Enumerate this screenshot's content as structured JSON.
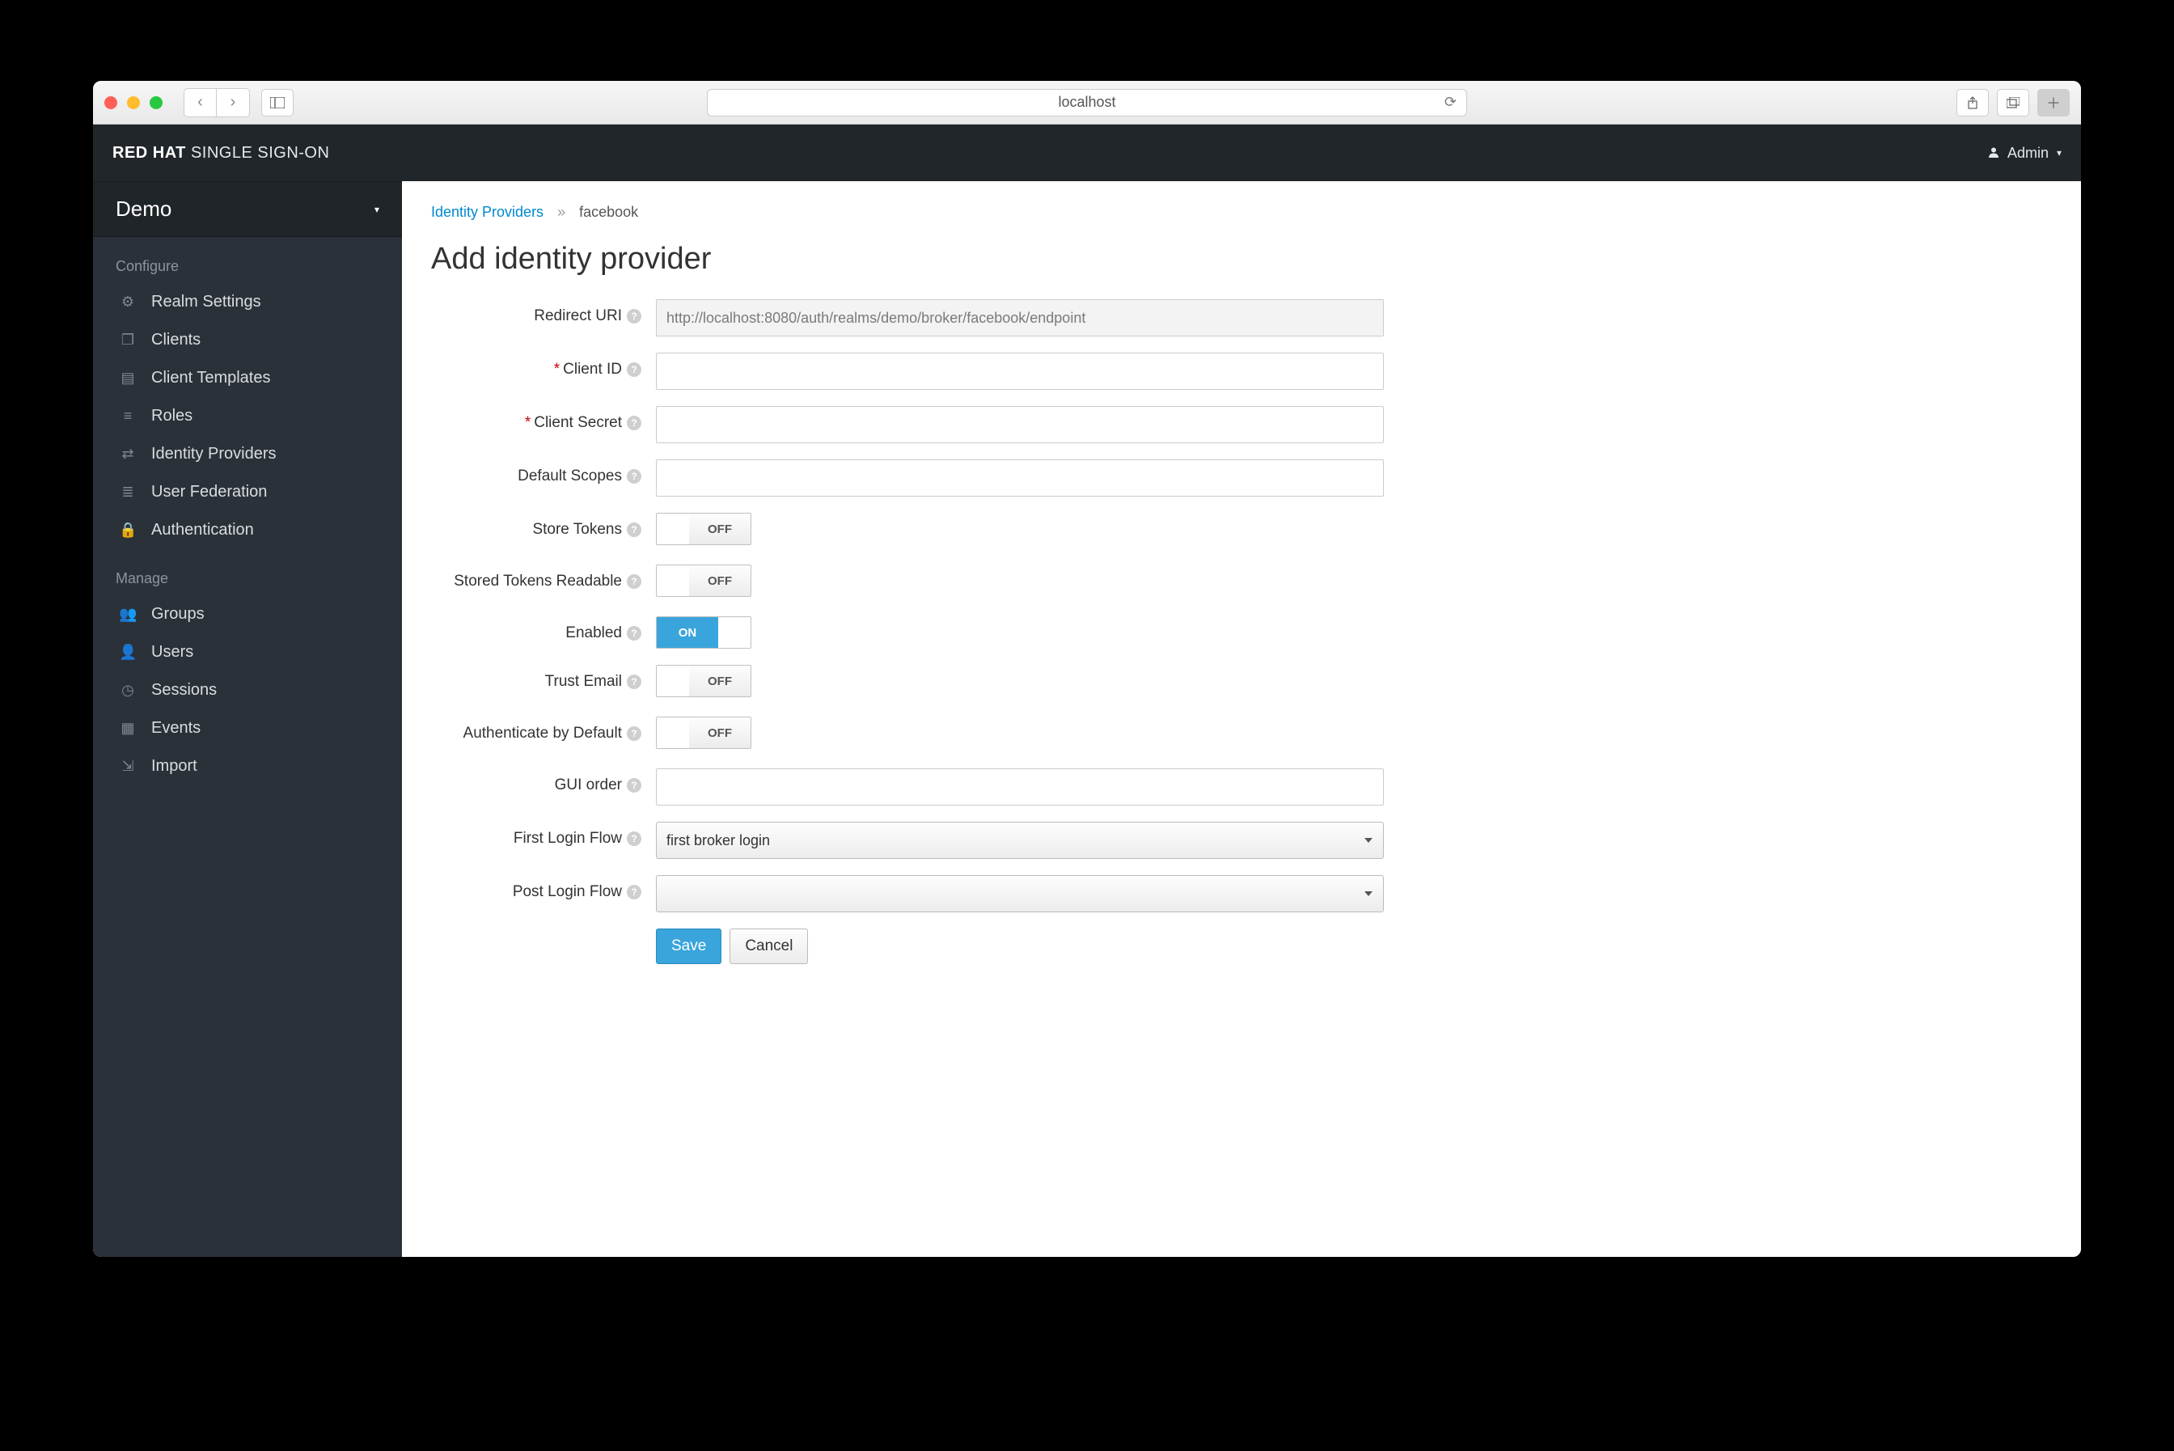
{
  "browser": {
    "url": "localhost"
  },
  "brand": {
    "bold": "RED HAT",
    "light": " SINGLE SIGN-ON"
  },
  "user": {
    "name": "Admin"
  },
  "realm": "Demo",
  "sidebar": {
    "sections": [
      {
        "label": "Configure",
        "items": [
          {
            "icon": "sliders",
            "label": "Realm Settings"
          },
          {
            "icon": "cube",
            "label": "Clients"
          },
          {
            "icon": "cubes",
            "label": "Client Templates"
          },
          {
            "icon": "list",
            "label": "Roles"
          },
          {
            "icon": "exchange",
            "label": "Identity Providers"
          },
          {
            "icon": "database",
            "label": "User Federation"
          },
          {
            "icon": "lock",
            "label": "Authentication"
          }
        ]
      },
      {
        "label": "Manage",
        "items": [
          {
            "icon": "users",
            "label": "Groups"
          },
          {
            "icon": "user",
            "label": "Users"
          },
          {
            "icon": "clock",
            "label": "Sessions"
          },
          {
            "icon": "calendar",
            "label": "Events"
          },
          {
            "icon": "import",
            "label": "Import"
          }
        ]
      }
    ]
  },
  "breadcrumb": {
    "link": "Identity Providers",
    "current": "facebook"
  },
  "page_title": "Add identity provider",
  "fields": {
    "redirect_uri": {
      "label": "Redirect URI",
      "value": "http://localhost:8080/auth/realms/demo/broker/facebook/endpoint"
    },
    "client_id": {
      "label": "Client ID",
      "required": true,
      "value": ""
    },
    "client_secret": {
      "label": "Client Secret",
      "required": true,
      "value": ""
    },
    "default_scopes": {
      "label": "Default Scopes",
      "value": ""
    },
    "store_tokens": {
      "label": "Store Tokens",
      "state": "OFF"
    },
    "stored_tokens_readable": {
      "label": "Stored Tokens Readable",
      "state": "OFF"
    },
    "enabled": {
      "label": "Enabled",
      "state": "ON"
    },
    "trust_email": {
      "label": "Trust Email",
      "state": "OFF"
    },
    "auth_default": {
      "label": "Authenticate by Default",
      "state": "OFF"
    },
    "gui_order": {
      "label": "GUI order",
      "value": ""
    },
    "first_login_flow": {
      "label": "First Login Flow",
      "value": "first broker login"
    },
    "post_login_flow": {
      "label": "Post Login Flow",
      "value": ""
    }
  },
  "buttons": {
    "save": "Save",
    "cancel": "Cancel"
  },
  "icons": {
    "sliders": "⚙",
    "cube": "❐",
    "cubes": "▤",
    "list": "≡",
    "exchange": "⇄",
    "database": "≣",
    "lock": "🔒",
    "users": "👥",
    "user": "👤",
    "clock": "◷",
    "calendar": "▦",
    "import": "⇲"
  }
}
